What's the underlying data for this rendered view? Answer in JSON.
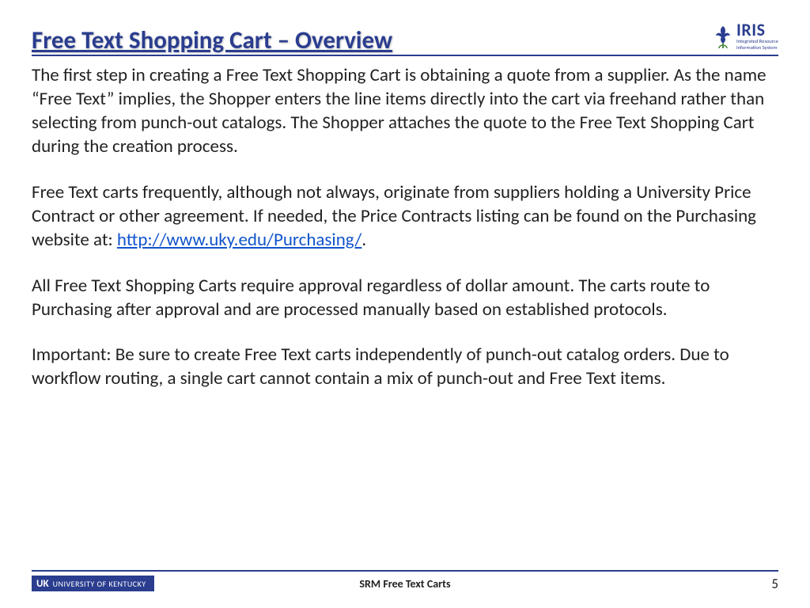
{
  "header": {
    "title": "Free Text Shopping Cart – Overview",
    "logo": {
      "main": "IRIS",
      "sub1": "Integrated Resource",
      "sub2": "Information System"
    }
  },
  "body": {
    "p1": "The first step in creating a Free Text Shopping Cart is obtaining a quote from a supplier. As the name “Free Text” implies, the Shopper enters the line items directly into the cart via freehand rather than selecting from punch-out catalogs. The Shopper attaches the quote to the Free Text Shopping Cart during the creation process.",
    "p2a": "Free Text carts frequently, although not always, originate from suppliers holding a University Price Contract or other agreement. If needed, the Price Contracts listing can be found on the Purchasing website at: ",
    "p2link": "http://www.uky.edu/Purchasing/",
    "p2b": ".",
    "p3": "All Free Text Shopping Carts require approval regardless of dollar amount. The carts route to Purchasing after approval and are processed manually based on established protocols.",
    "p4": "Important: Be sure to create Free Text carts independently of punch-out catalog orders. Due to workflow routing, a single cart cannot contain a mix of punch-out and Free Text items."
  },
  "footer": {
    "org_prefix": "UK",
    "org": "UNIVERSITY OF KENTUCKY",
    "center": "SRM Free Text Carts",
    "page": "5"
  }
}
